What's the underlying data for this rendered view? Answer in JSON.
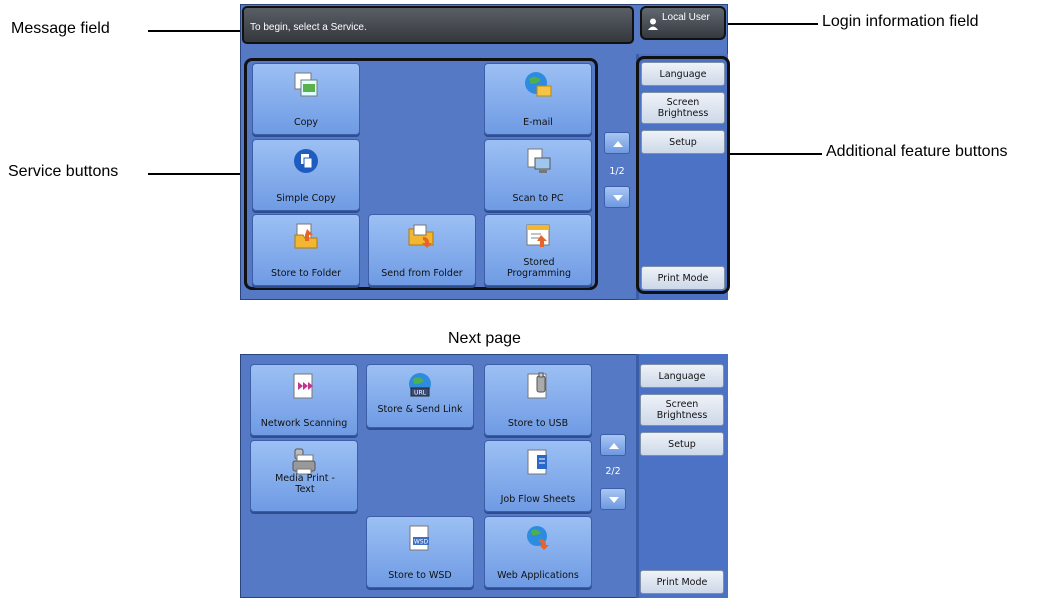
{
  "callouts": {
    "message_field": "Message field",
    "service_buttons": "Service buttons",
    "login_field": "Login information field",
    "additional_buttons": "Additional feature buttons"
  },
  "next_page_caption": "Next page",
  "screen1": {
    "message": "To begin, select a Service.",
    "login": "Local User",
    "page_indicator": "1/2",
    "services": [
      "Copy",
      "E-mail",
      "Simple Copy",
      "Scan to PC",
      "Store to Folder",
      "Send from Folder",
      "Stored Programming"
    ],
    "side_buttons": [
      "Language",
      "Screen Brightness",
      "Setup",
      "Print Mode"
    ]
  },
  "screen2": {
    "page_indicator": "2/2",
    "services": [
      "Network Scanning",
      "Store & Send Link",
      "Store to USB",
      "Media Print - Text",
      "Job Flow Sheets",
      "Store to WSD",
      "Web Applications"
    ],
    "side_buttons": [
      "Language",
      "Screen Brightness",
      "Setup",
      "Print Mode"
    ]
  },
  "colors": {
    "screen_blue": "#4b72c4",
    "button_blue": "#8ab0ee",
    "message_bg": "#3f444a"
  }
}
